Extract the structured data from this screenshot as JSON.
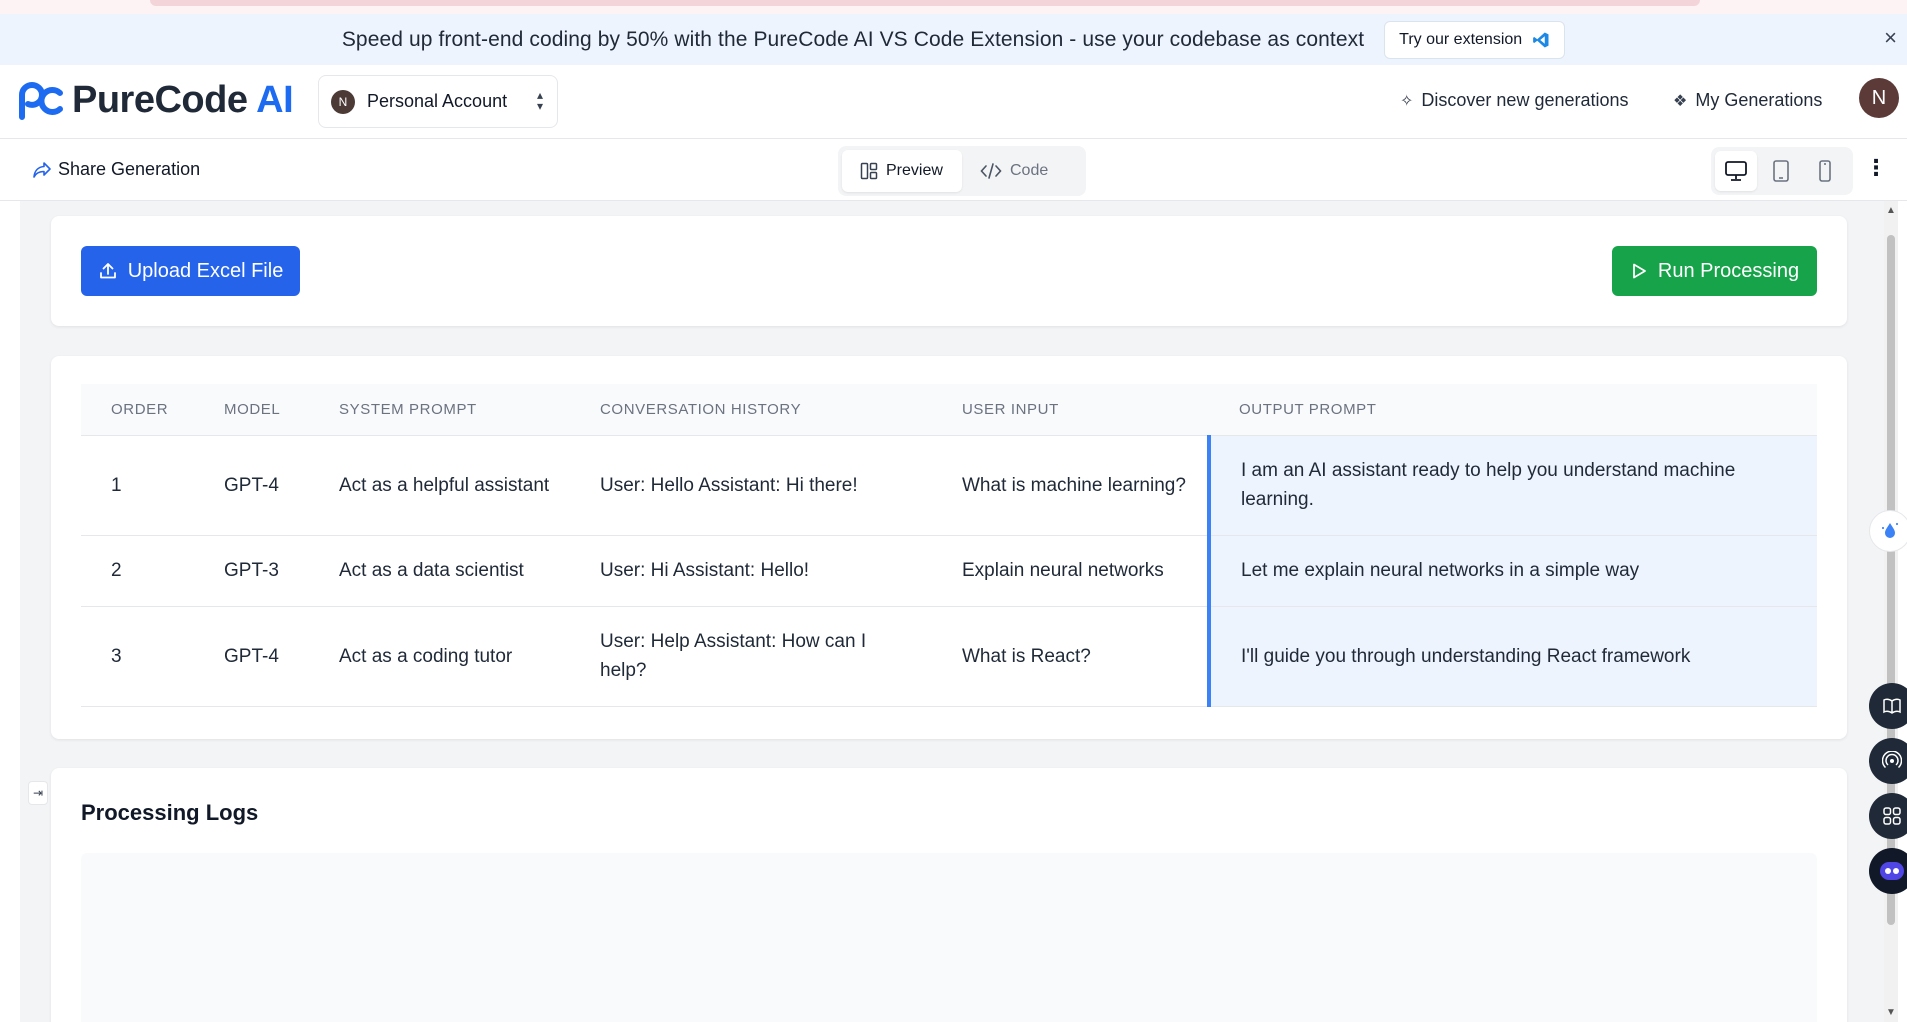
{
  "banner": {
    "text": "Speed up front-end coding by 50% with the PureCode AI VS Code Extension - use your codebase as context",
    "button_label": "Try our extension",
    "close": "×"
  },
  "header": {
    "logo_text": "PureCode",
    "logo_ai": "AI",
    "account_initial": "N",
    "account_name": "Personal Account",
    "discover_label": "Discover new generations",
    "my_generations_label": "My Generations",
    "user_initial": "N"
  },
  "toolbar": {
    "share_label": "Share Generation",
    "tabs": [
      {
        "label": "Preview",
        "active": true
      },
      {
        "label": "Code",
        "active": false
      }
    ]
  },
  "actions": {
    "upload_label": "Upload Excel File",
    "run_label": "Run Processing"
  },
  "table": {
    "columns": [
      "ORDER",
      "MODEL",
      "SYSTEM PROMPT",
      "CONVERSATION HISTORY",
      "USER INPUT",
      "OUTPUT PROMPT"
    ],
    "rows": [
      [
        "1",
        "GPT-4",
        "Act as a helpful assistant",
        "User: Hello Assistant: Hi there!",
        "What is machine learning?",
        "I am an AI assistant ready to help you understand machine learning."
      ],
      [
        "2",
        "GPT-3",
        "Act as a data scientist",
        "User: Hi Assistant: Hello!",
        "Explain neural networks",
        "Let me explain neural networks in a simple way"
      ],
      [
        "3",
        "GPT-4",
        "Act as a coding tutor",
        "User: Help Assistant: How can I help?",
        "What is React?",
        "I'll guide you through understanding React framework"
      ]
    ]
  },
  "logs": {
    "title": "Processing Logs"
  },
  "colors": {
    "primary": "#2563eb",
    "success": "#16a34a",
    "brand": "#1d6bf0",
    "output_highlight": "#eef4fd"
  }
}
